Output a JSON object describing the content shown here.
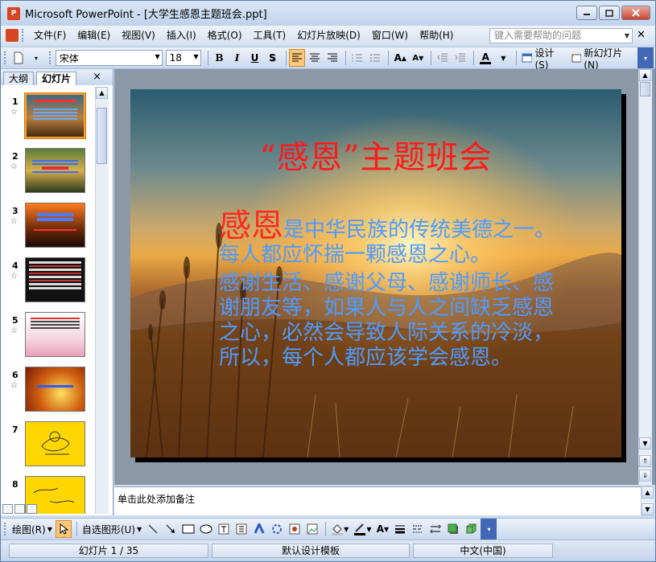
{
  "window": {
    "title": "Microsoft PowerPoint - [大学生感恩主题班会.ppt]",
    "app_icon": "P"
  },
  "menu": {
    "items": [
      "文件(F)",
      "编辑(E)",
      "视图(V)",
      "插入(I)",
      "格式(O)",
      "工具(T)",
      "幻灯片放映(D)",
      "窗口(W)",
      "帮助(H)"
    ],
    "help_placeholder": "键入需要帮助的问题"
  },
  "toolbar": {
    "font_name": "宋体",
    "font_size": "18",
    "bold": "B",
    "italic": "I",
    "underline": "U",
    "shadow": "S",
    "design_label": "设计(S)",
    "new_slide_label": "新幻灯片(N)"
  },
  "left_pane": {
    "tab_outline": "大纲",
    "tab_slides": "幻灯片",
    "close": "×",
    "slides": [
      {
        "num": "1"
      },
      {
        "num": "2"
      },
      {
        "num": "3"
      },
      {
        "num": "4"
      },
      {
        "num": "5"
      },
      {
        "num": "6"
      },
      {
        "num": "7"
      },
      {
        "num": "8"
      }
    ]
  },
  "slide": {
    "title": "“感恩”主题班会",
    "big_word": "感恩",
    "para1_rest": "是中华民族的传统美德之一。每人都应怀揣一颗感恩之心。",
    "para2": "感谢生活、感谢父母、感谢师长、感谢朋友等，如果人与人之间缺乏感恩之心，必然会导致人际关系的冷淡，所以，每个人都应该学会感恩。"
  },
  "notes": {
    "placeholder": "单击此处添加备注"
  },
  "drawbar": {
    "draw_label": "绘图(R)",
    "autoshape_label": "自选图形(U)"
  },
  "status": {
    "slide_info": "幻灯片 1 / 35",
    "template": "默认设计模板",
    "language": "中文(中国)"
  }
}
